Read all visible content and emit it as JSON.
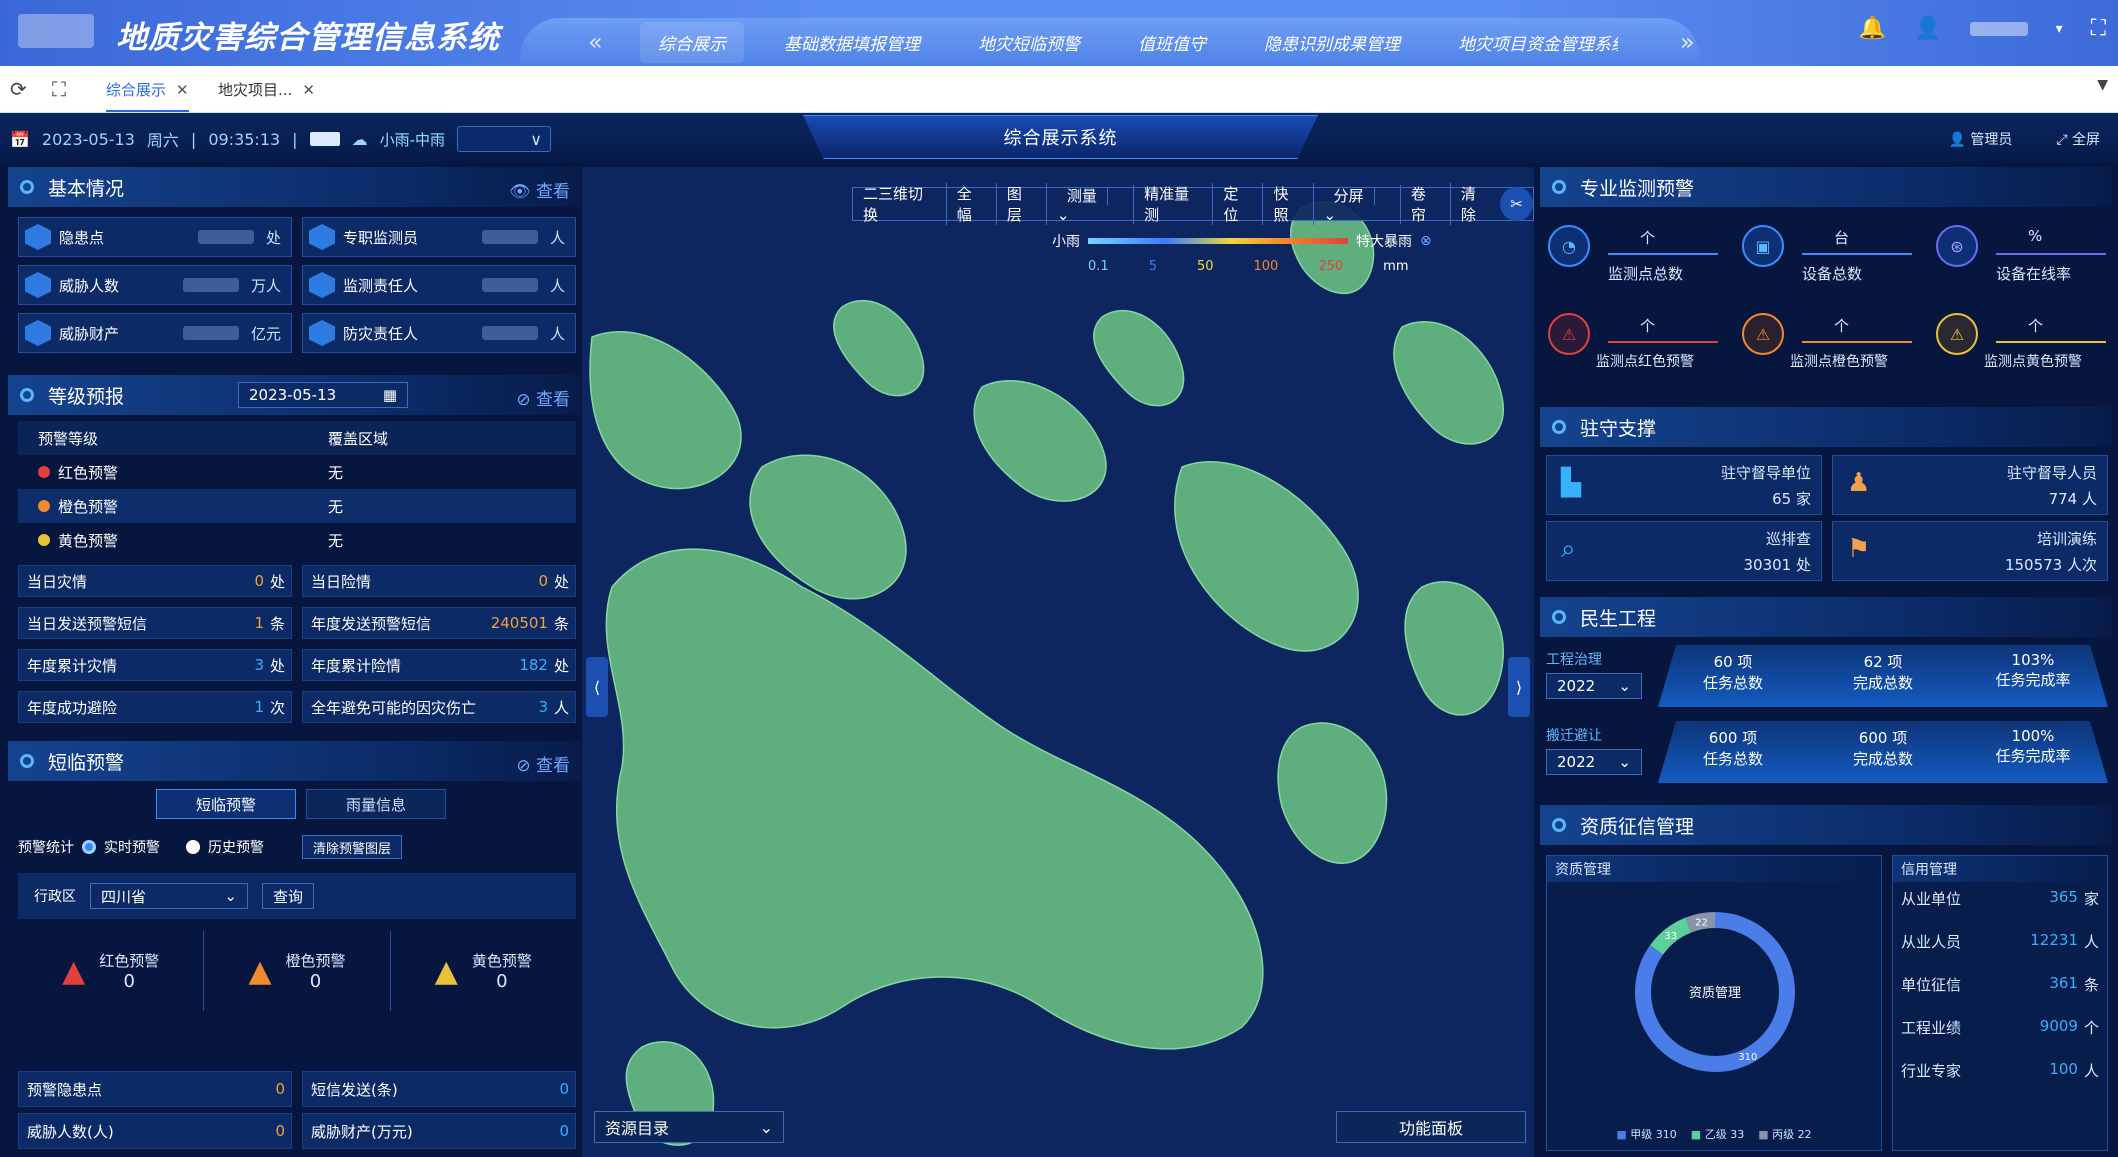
{
  "app": {
    "title": "地质灾害综合管理信息系统"
  },
  "nav": {
    "items": [
      "综合展示",
      "基础数据填报管理",
      "地灾短临预警",
      "值班值守",
      "隐患识别成果管理",
      "地灾项目资金管理系统"
    ]
  },
  "tabs": [
    {
      "label": "综合展示"
    },
    {
      "label": "地灾项目..."
    }
  ],
  "infobar": {
    "date": "2023-05-13",
    "weekday": "周六",
    "time": "09:35:13",
    "weather": "小雨-中雨",
    "center_title": "综合展示系统",
    "admin": "管理员",
    "fullscreen": "全屏"
  },
  "basic": {
    "title": "基本情况",
    "more": "查看",
    "cards": [
      {
        "label": "隐患点",
        "unit": "处"
      },
      {
        "label": "专职监测员",
        "unit": "人"
      },
      {
        "label": "威胁人数",
        "unit": "万人"
      },
      {
        "label": "监测责任人",
        "unit": "人"
      },
      {
        "label": "威胁财产",
        "unit": "亿元"
      },
      {
        "label": "防灾责任人",
        "unit": "人"
      }
    ]
  },
  "grade": {
    "title": "等级预报",
    "date": "2023-05-13",
    "more": "查看",
    "col1": "预警等级",
    "col2": "覆盖区域",
    "rows": [
      {
        "level": "红色预警",
        "area": "无",
        "color": "#e0413a"
      },
      {
        "level": "橙色预警",
        "area": "无",
        "color": "#f08a2c"
      },
      {
        "level": "黄色预警",
        "area": "无",
        "color": "#e9c238"
      }
    ]
  },
  "stats": [
    {
      "label": "当日灾情",
      "value": "0",
      "unit": "处"
    },
    {
      "label": "当日险情",
      "value": "0",
      "unit": "处"
    },
    {
      "label": "当日发送预警短信",
      "value": "1",
      "unit": "条"
    },
    {
      "label": "年度发送预警短信",
      "value": "240501",
      "unit": "条"
    },
    {
      "label": "年度累计灾情",
      "value": "3",
      "unit": "处"
    },
    {
      "label": "年度累计险情",
      "value": "182",
      "unit": "处"
    },
    {
      "label": "年度成功避险",
      "value": "1",
      "unit": "次"
    },
    {
      "label": "全年避免可能的因灾伤亡",
      "value": "3",
      "unit": "人"
    }
  ],
  "short": {
    "title": "短临预警",
    "more": "查看",
    "tab1": "短临预警",
    "tab2": "雨量信息",
    "stat_label": "预警统计",
    "opt1": "实时预警",
    "opt2": "历史预警",
    "clear_btn": "清除预警图层",
    "region_label": "行政区",
    "region": "四川省",
    "query": "查询",
    "warnings": [
      {
        "label": "红色预警",
        "value": "0",
        "color": "#e0413a"
      },
      {
        "label": "橙色预警",
        "value": "0",
        "color": "#f08a2c"
      },
      {
        "label": "黄色预警",
        "value": "0",
        "color": "#e9c238"
      }
    ],
    "bottom": [
      {
        "label": "预警隐患点",
        "value": "0"
      },
      {
        "label": "短信发送(条)",
        "value": "0"
      },
      {
        "label": "威胁人数(人)",
        "value": "0"
      },
      {
        "label": "威胁财产(万元)",
        "value": "0"
      }
    ]
  },
  "map": {
    "toolbar": [
      "二三维切换",
      "全幅",
      "图层",
      "测量",
      "精准量测",
      "定位",
      "快照",
      "分屏",
      "卷帘",
      "清除"
    ],
    "legend_left": "小雨",
    "legend_right": "特大暴雨",
    "legend_ticks": [
      "0.1",
      "5",
      "50",
      "100",
      "250"
    ],
    "legend_unit": "mm",
    "resource": "资源目录",
    "function": "功能面板"
  },
  "monitor": {
    "title": "专业监测预警",
    "items": [
      {
        "label": "监测点总数",
        "unit": "个"
      },
      {
        "label": "设备总数",
        "unit": "台"
      },
      {
        "label": "设备在线率",
        "unit": "%"
      },
      {
        "label": "监测点红色预警",
        "unit": "个"
      },
      {
        "label": "监测点橙色预警",
        "unit": "个"
      },
      {
        "label": "监测点黄色预警",
        "unit": "个"
      }
    ]
  },
  "station": {
    "title": "驻守支撑",
    "items": [
      {
        "label": "驻守督导单位",
        "value": "65",
        "unit": "家"
      },
      {
        "label": "驻守督导人员",
        "value": "774",
        "unit": "人"
      },
      {
        "label": "巡排查",
        "value": "30301",
        "unit": "处"
      },
      {
        "label": "培训演练",
        "value": "150573",
        "unit": "人次"
      }
    ]
  },
  "people": {
    "title": "民生工程",
    "groups": [
      {
        "label": "工程治理",
        "year": "2022",
        "a": "60 项",
        "b": "62 项",
        "c": "103%"
      },
      {
        "label": "搬迁避让",
        "year": "2022",
        "a": "600 项",
        "b": "600 项",
        "c": "100%"
      }
    ],
    "a_label": "任务总数",
    "b_label": "完成总数",
    "c_label": "任务完成率"
  },
  "quali": {
    "title": "资质征信管理",
    "left_title": "资质管理",
    "right_title": "信用管理",
    "donut_center": "资质管理",
    "donut": [
      {
        "name": "甲级",
        "value": 310,
        "color": "#4a7de8"
      },
      {
        "name": "乙级",
        "value": 33,
        "color": "#5ccf9c"
      },
      {
        "name": "丙级",
        "value": 22,
        "color": "#8a94a8"
      }
    ],
    "credit": [
      {
        "label": "从业单位",
        "value": "365",
        "unit": "家"
      },
      {
        "label": "从业人员",
        "value": "12231",
        "unit": "人"
      },
      {
        "label": "单位征信",
        "value": "361",
        "unit": "条"
      },
      {
        "label": "工程业绩",
        "value": "9009",
        "unit": "个"
      },
      {
        "label": "行业专家",
        "value": "100",
        "unit": "人"
      }
    ]
  }
}
